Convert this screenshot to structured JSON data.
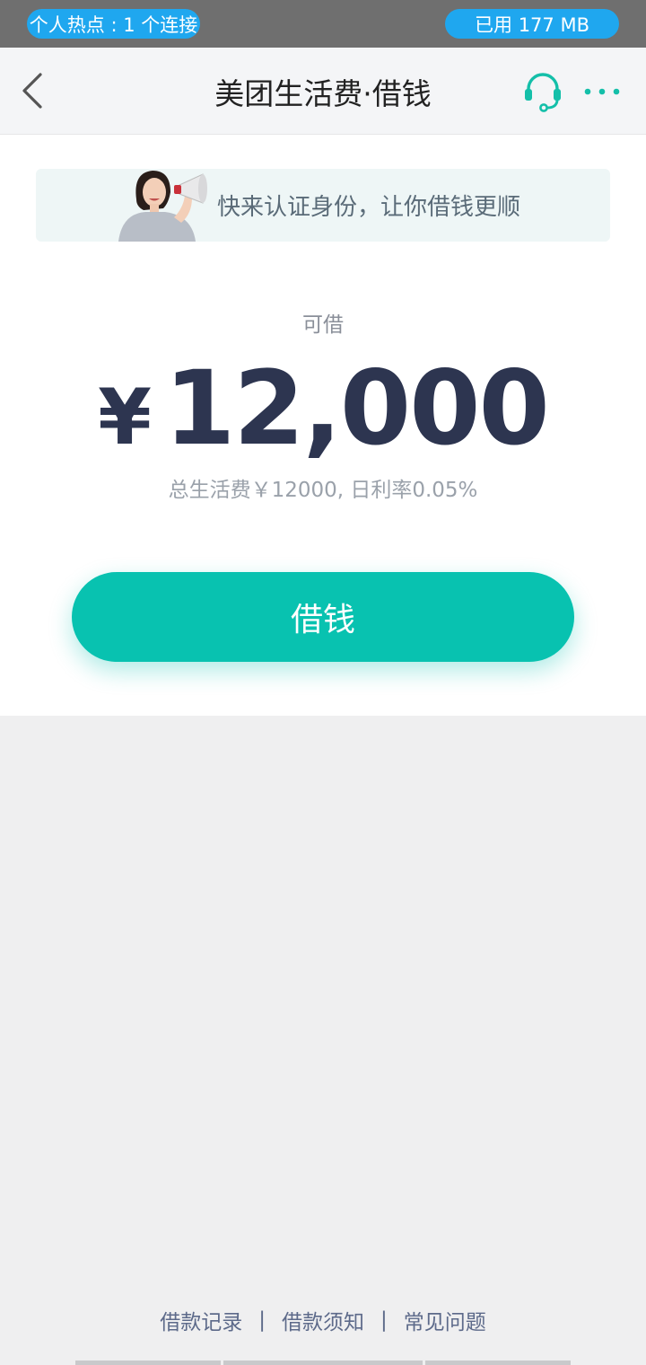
{
  "status_bar": {
    "hotspot_text": "个人热点 : 1 个连接",
    "data_used_text": "已用 177 MB"
  },
  "header": {
    "title": "美团生活费·借钱",
    "back_icon": "chevron-left-icon",
    "service_icon": "headset-icon",
    "more_icon": "more-dots-icon"
  },
  "banner": {
    "text": "快来认证身份，让你借钱更顺",
    "image": "woman-megaphone-illustration"
  },
  "loan": {
    "available_label": "可借",
    "currency": "¥",
    "amount": "12,000",
    "description": "总生活费￥12000, 日利率0.05%"
  },
  "borrow_button": {
    "label": "借钱"
  },
  "footer": {
    "links": [
      "借款记录",
      "借款须知",
      "常见问题"
    ],
    "separator": "|"
  },
  "colors": {
    "accent": "#08c2b0",
    "amount_text": "#2d3550",
    "status_pill": "#1fa7ef"
  }
}
